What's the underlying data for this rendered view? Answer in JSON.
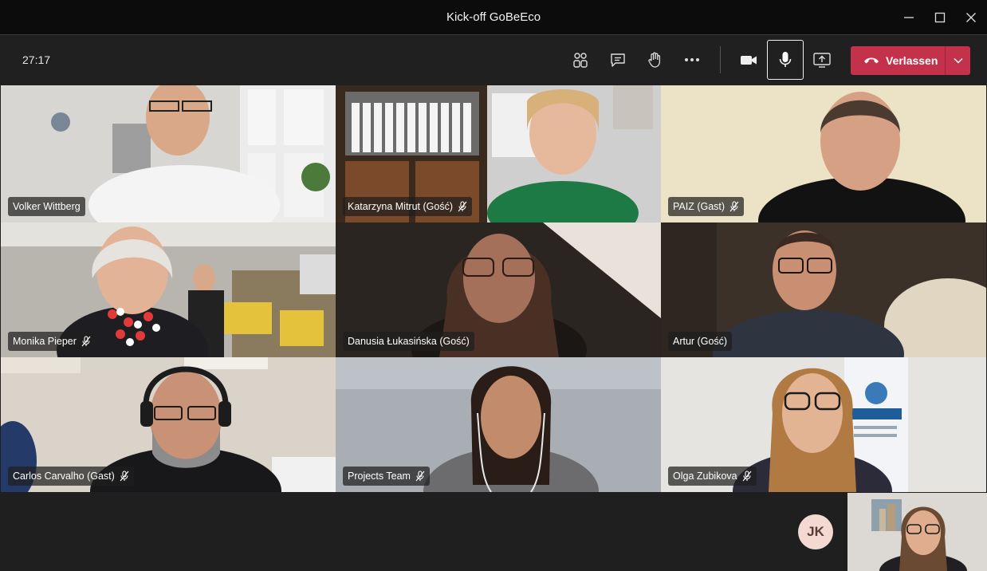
{
  "window": {
    "title": "Kick-off GoBeEco"
  },
  "toolbar": {
    "timer": "27:17",
    "icons": [
      "participants-icon",
      "chat-icon",
      "raise-hand-icon",
      "more-icon",
      "camera-icon",
      "microphone-icon",
      "share-screen-icon"
    ],
    "leave_label": "Verlassen",
    "leave_color": "#c4314b"
  },
  "participants": [
    {
      "name": "Volker Wittberg",
      "muted": false
    },
    {
      "name": "Katarzyna Mitrut (Gość)",
      "muted": true
    },
    {
      "name": "PAIZ (Gast)",
      "muted": true
    },
    {
      "name": "Monika Pieper",
      "muted": true
    },
    {
      "name": "Danusia Łukasińska (Gość)",
      "muted": false
    },
    {
      "name": "Artur (Gość)",
      "muted": false
    },
    {
      "name": "Carlos Carvalho (Gast)",
      "muted": true
    },
    {
      "name": "Projects Team",
      "muted": true
    },
    {
      "name": "Olga Zubikova",
      "muted": true
    }
  ],
  "bottom_bar": {
    "avatar_initials": "JK"
  }
}
